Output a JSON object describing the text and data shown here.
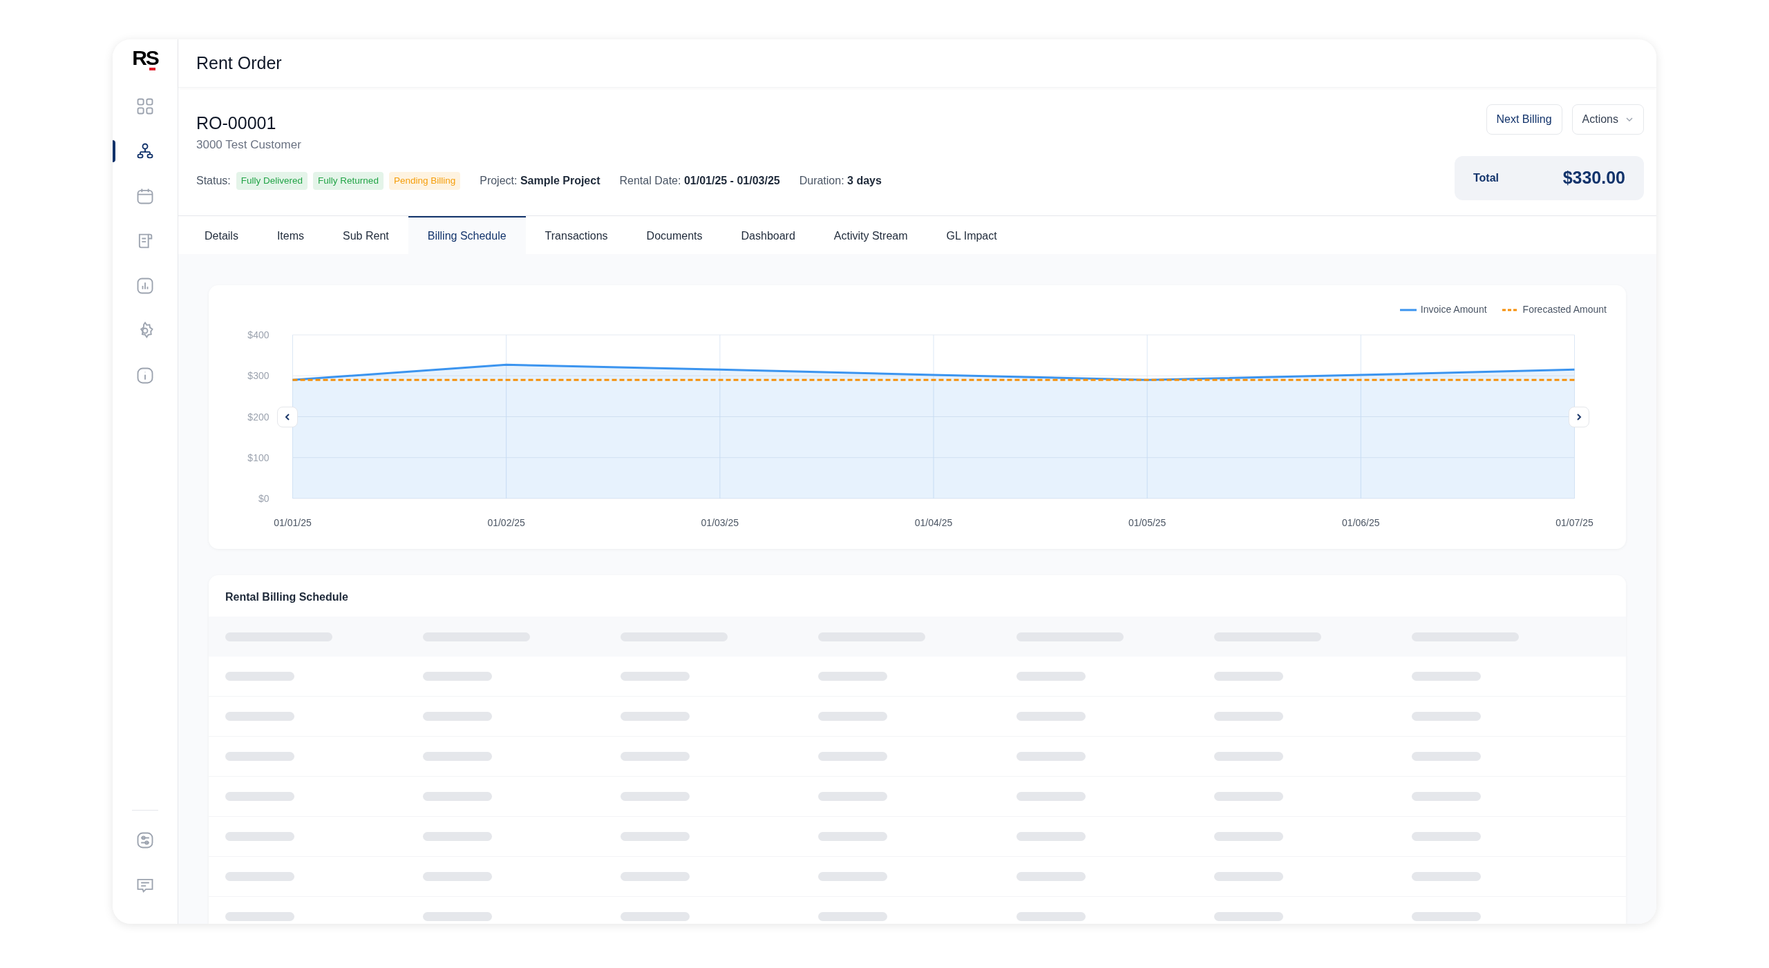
{
  "sidebar": {
    "logo": "RS",
    "nav_items": [
      {
        "selected": false
      },
      {
        "selected": true
      },
      {
        "selected": false
      },
      {
        "selected": false
      },
      {
        "selected": false
      },
      {
        "selected": false
      },
      {
        "selected": false
      }
    ],
    "bottom_items": [
      {
        "selected": false
      },
      {
        "selected": false
      }
    ]
  },
  "header": {
    "title": "Rent Order"
  },
  "order": {
    "number": "RO-00001",
    "customer": "3000 Test Customer",
    "status_label": "Status:",
    "badges": [
      {
        "label": "Fully Delivered",
        "color": "#22a447"
      },
      {
        "label": "Fully Returned",
        "color": "#22a447"
      },
      {
        "label": "Pending Billing",
        "color": "#f59e0b"
      }
    ],
    "meta": [
      {
        "label": "Project:",
        "value": "Sample Project"
      },
      {
        "label": "Rental Date:",
        "value": "01/01/25 - 01/03/25"
      },
      {
        "label": "Duration:",
        "value": "3 days"
      }
    ],
    "buttons": [
      {
        "label": "Next Billing",
        "kind": "plain"
      },
      {
        "label": "Actions",
        "kind": "dropdown"
      }
    ],
    "total": {
      "label": "Total",
      "value": "$330.00"
    }
  },
  "tabs": [
    {
      "label": "Details",
      "selected": false
    },
    {
      "label": "Items",
      "selected": false
    },
    {
      "label": "Sub Rent",
      "selected": false
    },
    {
      "label": "Billing Schedule",
      "selected": true
    },
    {
      "label": "Transactions",
      "selected": false
    },
    {
      "label": "Documents",
      "selected": false
    },
    {
      "label": "Dashboard",
      "selected": false
    },
    {
      "label": "Activity Stream",
      "selected": false
    },
    {
      "label": "GL Impact",
      "selected": false
    }
  ],
  "chart": {
    "chart_data": {
      "type": "area",
      "grid": true,
      "x": [
        "01/01/25",
        "01/02/25",
        "01/03/25",
        "01/04/25",
        "01/05/25",
        "01/06/25",
        "01/07/25"
      ],
      "ylim": [
        0,
        400
      ],
      "yticks": [
        {
          "value": 0,
          "label": "$0"
        },
        {
          "value": 100,
          "label": "$100"
        },
        {
          "value": 200,
          "label": "$200"
        },
        {
          "value": 300,
          "label": "$300"
        },
        {
          "value": 400,
          "label": "$400"
        }
      ],
      "series": [
        {
          "name": "Invoice Amount",
          "line_style": "solid",
          "color": "#3b94ef",
          "values": [
            290,
            327,
            315,
            302,
            290,
            302,
            315
          ]
        },
        {
          "name": "Forecasted Amount",
          "type": "line",
          "line_style": "dashed",
          "color": "#f5900b",
          "values": [
            290,
            290,
            290,
            290,
            290,
            290,
            290
          ]
        }
      ]
    }
  },
  "schedule": {
    "title": "Rental Billing Schedule"
  }
}
